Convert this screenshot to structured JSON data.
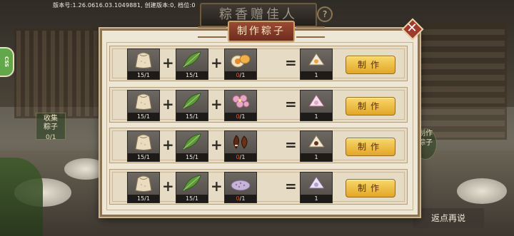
{
  "top": {
    "version": "版本号:1.26.0616.03.1049881, 创建版本:0, 档位:0",
    "title": "粽香赠佳人",
    "help": "?"
  },
  "side_pill": "CSS",
  "background": {
    "left_tag": "收集\n粽子",
    "left_count": "0/1",
    "right_tag": "制作\n粽子",
    "bottom_button": "返点再说"
  },
  "dialog": {
    "title": "制作粽子",
    "close_icon": "close-x-icon",
    "plus": "+",
    "equals": "="
  },
  "recipes": [
    {
      "ingredients": [
        {
          "icon": "glutinous-rice-sack-icon",
          "have": "15",
          "need": "1",
          "short": false
        },
        {
          "icon": "bamboo-leaf-icon",
          "have": "15",
          "need": "1",
          "short": false
        },
        {
          "icon": "egg-yolk-icon",
          "have": "0",
          "need": "1",
          "short": true
        }
      ],
      "result": {
        "icon": "yolk-zongzi-icon",
        "count": "1"
      },
      "button": "制作"
    },
    {
      "ingredients": [
        {
          "icon": "glutinous-rice-sack-icon",
          "have": "15",
          "need": "1",
          "short": false
        },
        {
          "icon": "bamboo-leaf-icon",
          "have": "15",
          "need": "1",
          "short": false
        },
        {
          "icon": "pink-flower-icon",
          "have": "0",
          "need": "1",
          "short": true
        }
      ],
      "result": {
        "icon": "flower-zongzi-icon",
        "count": "1"
      },
      "button": "制作"
    },
    {
      "ingredients": [
        {
          "icon": "glutinous-rice-sack-icon",
          "have": "15",
          "need": "1",
          "short": false
        },
        {
          "icon": "bamboo-leaf-icon",
          "have": "15",
          "need": "1",
          "short": false
        },
        {
          "icon": "chestnut-icon",
          "have": "0",
          "need": "1",
          "short": true
        }
      ],
      "result": {
        "icon": "chestnut-zongzi-icon",
        "count": "1"
      },
      "button": "制作"
    },
    {
      "ingredients": [
        {
          "icon": "glutinous-rice-sack-icon",
          "have": "15",
          "need": "1",
          "short": false
        },
        {
          "icon": "bamboo-leaf-icon",
          "have": "15",
          "need": "1",
          "short": false
        },
        {
          "icon": "purple-rice-icon",
          "have": "0",
          "need": "1",
          "short": true
        }
      ],
      "result": {
        "icon": "purple-rice-zongzi-icon",
        "count": "1"
      },
      "button": "制作"
    }
  ],
  "colors": {
    "button_gold": "#f2c44a",
    "short_red": "#e0523a",
    "dialog_bg": "#efe7d6",
    "title_red": "#8a3a28"
  }
}
